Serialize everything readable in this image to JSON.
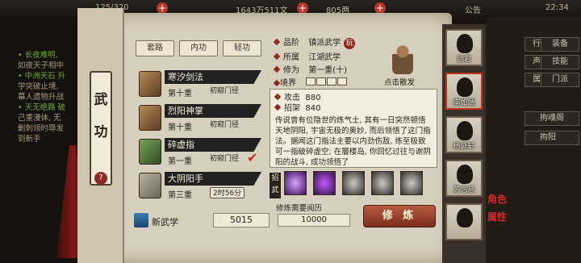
{
  "topbar": {
    "stamina": "125/320",
    "coins": "1643万511文",
    "gems": "805两",
    "notice": "公告",
    "clock": "22:34"
  },
  "log": [
    {
      "text": "• 长夜难明,",
      "dim": false
    },
    {
      "text": "  如夜天子相中",
      "dim": true
    },
    {
      "text": "• 中洲天石 升",
      "dim": false
    },
    {
      "text": "  学突破止境,",
      "dim": true
    },
    {
      "text": "  幕人遗物升战",
      "dim": true
    },
    {
      "text": "• 天无绝路 破",
      "dim": false
    },
    {
      "text": "  己重漫体, 无",
      "dim": true
    },
    {
      "text": "  剿刺领时辱发",
      "dim": true
    },
    {
      "text": "  到新手",
      "dim": true
    }
  ],
  "scroll_label": {
    "line1": "武",
    "line2": "功",
    "badge": "?"
  },
  "tabs": [
    "套路",
    "内功",
    "轻功"
  ],
  "skills_list": [
    {
      "name": "寒汐剑法",
      "level": "第十重",
      "badge": "初窥门径",
      "badge_box": false,
      "book": "brown",
      "checked": false
    },
    {
      "name": "烈阳神掌",
      "level": "第十重",
      "badge": "初窥门径",
      "badge_box": false,
      "book": "brown",
      "checked": false
    },
    {
      "name": "碎虚指",
      "level": "第一重",
      "badge": "初窥门径",
      "badge_box": false,
      "book": "green",
      "checked": true
    },
    {
      "name": "大阴阳手",
      "level": "第三重",
      "badge": "2时56分",
      "badge_box": true,
      "book": "gray",
      "checked": false
    }
  ],
  "new_skill": {
    "label": "新武学",
    "value": "5015"
  },
  "info": {
    "rank_label": "品阶",
    "rank": "镇派武学",
    "rank_tag": "玩",
    "school_label": "所属",
    "school": "江湖武学",
    "cultivation_label": "修为",
    "cultivation": "第一重(十)",
    "realm_label": "境界"
  },
  "meditate": {
    "label": "点击散发"
  },
  "stats": [
    {
      "label": "攻击",
      "value": "880"
    },
    {
      "label": "招架",
      "value": "840"
    }
  ],
  "description": "传说曾有位隐世的炼气士, 其有一日突然顿悟天地阴阳, 宇宙无极的奥妙, 而后领悟了这门指法。据闻这门指法主要以内劲伤敌, 练至极致可一指破碎虚空; 在層楼岛, 你回忆过往与谢阴阳的战斗, 成功领悟了",
  "skill_tag": "招武",
  "train": {
    "req_label": "修炼需要阅历",
    "req_value": "10000",
    "button": "修 炼"
  },
  "party": [
    {
      "name": "剑君",
      "active": false
    },
    {
      "name": "南如嫣",
      "active": true
    },
    {
      "name": "杨延轩",
      "active": false
    },
    {
      "name": "苏念慈",
      "active": false
    },
    {
      "name": "",
      "active": false
    }
  ],
  "right_panel": {
    "buttons": [
      "行动",
      "装备",
      "声威",
      "技能",
      "属性",
      "门派"
    ],
    "bar1": "拘魂阁",
    "bar2": "拘阳"
  },
  "role_badge": {
    "line1": "角色",
    "line2": "属性"
  },
  "colors": {
    "accent": "#8e2a20",
    "paper": "#d8d0bf",
    "ink": "#2a211a"
  }
}
